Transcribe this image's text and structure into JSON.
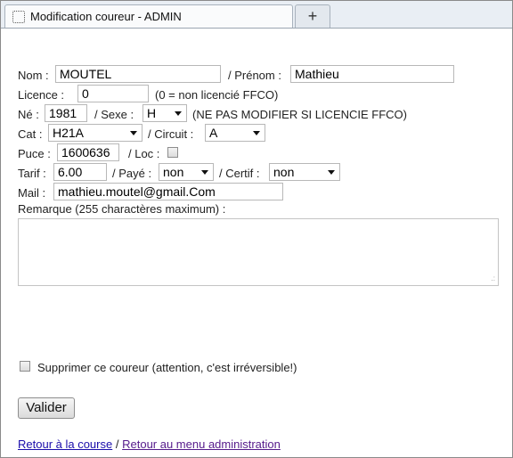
{
  "tab": {
    "title": "Modification coureur - ADMIN",
    "new_tab_glyph": "+"
  },
  "form": {
    "nom_label": "Nom :",
    "nom_value": "MOUTEL",
    "prenom_label": "/ Prénom :",
    "prenom_value": "Mathieu",
    "licence_label": "Licence :",
    "licence_value": "0",
    "licence_note": "(0 = non licencié FFCO)",
    "ne_label": "Né :",
    "ne_value": "1981",
    "sexe_label": "/ Sexe :",
    "sexe_value": "H",
    "sexe_note": "(NE PAS MODIFIER SI LICENCIE FFCO)",
    "cat_label": "Cat :",
    "cat_value": "H21A",
    "circuit_label": "/ Circuit :",
    "circuit_value": "A",
    "puce_label": "Puce :",
    "puce_value": "1600636",
    "loc_label": "/ Loc :",
    "loc_checked": false,
    "tarif_label": "Tarif :",
    "tarif_value": "6.00",
    "paye_label": "/ Payé :",
    "paye_value": "non",
    "certif_label": "/ Certif :",
    "certif_value": "non",
    "mail_label": "Mail :",
    "mail_value": "mathieu.moutel@gmail.Com",
    "remarque_label": "Remarque (255 charactères maximum) :",
    "remarque_value": "",
    "delete_label": "Supprimer ce coureur (attention, c'est irréversible!)",
    "delete_checked": false,
    "submit_label": "Valider"
  },
  "links": {
    "back_to_race": "Retour à la course",
    "separator": "/",
    "back_to_admin": "Retour au menu administration"
  },
  "icons": {
    "tab": "page-icon",
    "new_tab": "plus-icon",
    "dropdown": "chevron-down-icon",
    "resize": "resize-grip-icon"
  }
}
